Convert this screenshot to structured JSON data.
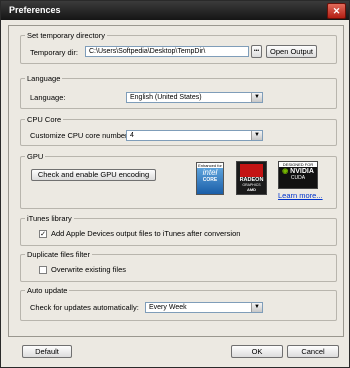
{
  "window": {
    "title": "Preferences",
    "close_glyph": "✕"
  },
  "temp_dir": {
    "legend": "Set temporary directory",
    "label": "Temporary dir:",
    "value": "C:\\Users\\Softpedia\\Desktop\\TempDir\\",
    "browse_label": "•••",
    "open_output": "Open Output"
  },
  "language": {
    "legend": "Language",
    "label": "Language:",
    "selected": "English (United States)"
  },
  "cpu": {
    "legend": "CPU Core",
    "label": "Customize CPU core number:",
    "selected": "4"
  },
  "gpu": {
    "legend": "GPU",
    "button": "Check and enable GPU encoding",
    "intel_top": "Enhanced for",
    "intel_brand": "intel",
    "intel_sub": "CORE",
    "amd_brand": "RADEON",
    "amd_sub": "GRAPHICS",
    "amd_foot": "AMD",
    "nvidia_top": "DESIGNED FOR",
    "nvidia_brand": "NVIDIA",
    "nvidia_sub": "CUDA",
    "learn_more": "Learn more..."
  },
  "itunes": {
    "legend": "iTunes library",
    "checkbox_label": "Add Apple Devices output files to iTunes after conversion",
    "checked": true
  },
  "duplicate": {
    "legend": "Duplicate files filter",
    "checkbox_label": "Overwrite existing files",
    "checked": false
  },
  "update": {
    "legend": "Auto update",
    "label": "Check for updates automatically:",
    "selected": "Every Week"
  },
  "buttons": {
    "default": "Default",
    "ok": "OK",
    "cancel": "Cancel"
  },
  "icons": {
    "arrow": "▼",
    "check": "✓"
  }
}
